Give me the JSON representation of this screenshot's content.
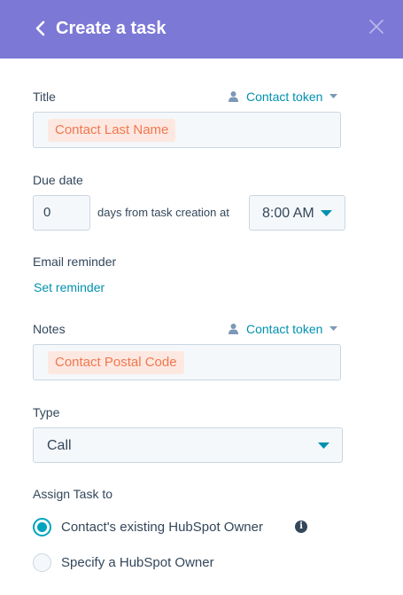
{
  "header": {
    "title": "Create a task",
    "back_icon": "chevron-left-icon",
    "close_icon": "close-icon",
    "color": "#7c78d6"
  },
  "title_field": {
    "label": "Title",
    "token_label": "Contact token",
    "value_token": "Contact Last Name"
  },
  "due_date": {
    "label": "Due date",
    "days_value": "0",
    "days_text": "days from task creation at",
    "time_value": "8:00 AM"
  },
  "email_reminder": {
    "label": "Email reminder",
    "link": "Set reminder"
  },
  "notes_field": {
    "label": "Notes",
    "token_label": "Contact token",
    "value_token": "Contact Postal Code"
  },
  "type_field": {
    "label": "Type",
    "value": "Call"
  },
  "assign": {
    "label": "Assign Task to",
    "options": [
      {
        "label": "Contact's existing HubSpot Owner",
        "selected": true
      },
      {
        "label": "Specify a HubSpot Owner",
        "selected": false
      }
    ]
  },
  "colors": {
    "accent": "#0091ae",
    "token_chip_text": "#f2774e",
    "token_chip_bg": "#fde8e1",
    "radio": "#00a4bd"
  }
}
